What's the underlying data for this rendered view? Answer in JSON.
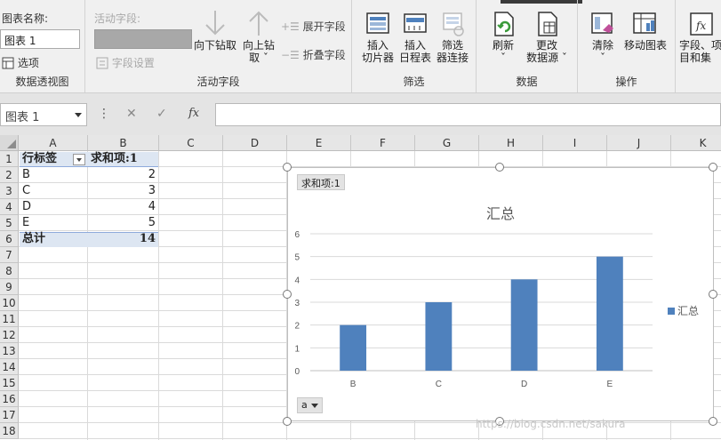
{
  "ribbon": {
    "pivottable": {
      "name_label": "图表名称:",
      "name_value": "图表 1",
      "options_label": "选项",
      "group_label": "数据透视图"
    },
    "active_field": {
      "label": "活动字段:",
      "field_settings_label": "字段设置",
      "drill_down_label": "向下钻取",
      "drill_up_label_1": "向上钻",
      "drill_up_label_2": "取 ˇ",
      "expand_label": "展开字段",
      "collapse_label": "折叠字段",
      "group_label": "活动字段"
    },
    "filter": {
      "slicer_1": "插入",
      "slicer_2": "切片器",
      "timeline_1": "插入",
      "timeline_2": "日程表",
      "connections_1": "筛选",
      "connections_2": "器连接",
      "group_label": "筛选"
    },
    "data": {
      "refresh_label": "刷新",
      "refresh_arrow": "ˇ",
      "change_source_1": "更改",
      "change_source_2": "数据源 ˇ",
      "group_label": "数据"
    },
    "actions": {
      "clear_label": "清除",
      "clear_arrow": "ˇ",
      "move_chart_label": "移动图表",
      "group_label": "操作"
    },
    "show": {
      "field_list_1": "字段、项",
      "field_list_2": "目和集"
    }
  },
  "formula_bar": {
    "name_box": "图表 1",
    "cancel_icon": "✕",
    "enter_icon": "✓",
    "fx_icon": "fx",
    "more_icon": "⋮"
  },
  "sheet": {
    "columns": [
      "A",
      "B",
      "C",
      "D",
      "E",
      "F",
      "G",
      "H",
      "I",
      "J",
      "K"
    ],
    "rows": [
      "1",
      "2",
      "3",
      "4",
      "5",
      "6",
      "7",
      "8",
      "9",
      "10",
      "11",
      "12",
      "13",
      "14",
      "15",
      "16",
      "17",
      "18"
    ],
    "pivot": {
      "row_label_header": "行标签",
      "sum_header": "求和项:1",
      "items": [
        {
          "label": "B",
          "value": "2"
        },
        {
          "label": "C",
          "value": "3"
        },
        {
          "label": "D",
          "value": "4"
        },
        {
          "label": "E",
          "value": "5"
        }
      ],
      "total_label": "总计",
      "total_value": "14"
    }
  },
  "chart": {
    "field_button": "求和项:1",
    "axis_button": "a",
    "series_color": "#4f81bd"
  },
  "chart_data": {
    "type": "bar",
    "title": "汇总",
    "categories": [
      "B",
      "C",
      "D",
      "E"
    ],
    "series": [
      {
        "name": "汇总",
        "values": [
          2,
          3,
          4,
          5
        ]
      }
    ],
    "ylim": [
      0,
      6
    ],
    "yticks": [
      0,
      1,
      2,
      3,
      4,
      5,
      6
    ],
    "grid": true,
    "legend": "right"
  },
  "watermark": "https://blog.csdn.net/sakura"
}
